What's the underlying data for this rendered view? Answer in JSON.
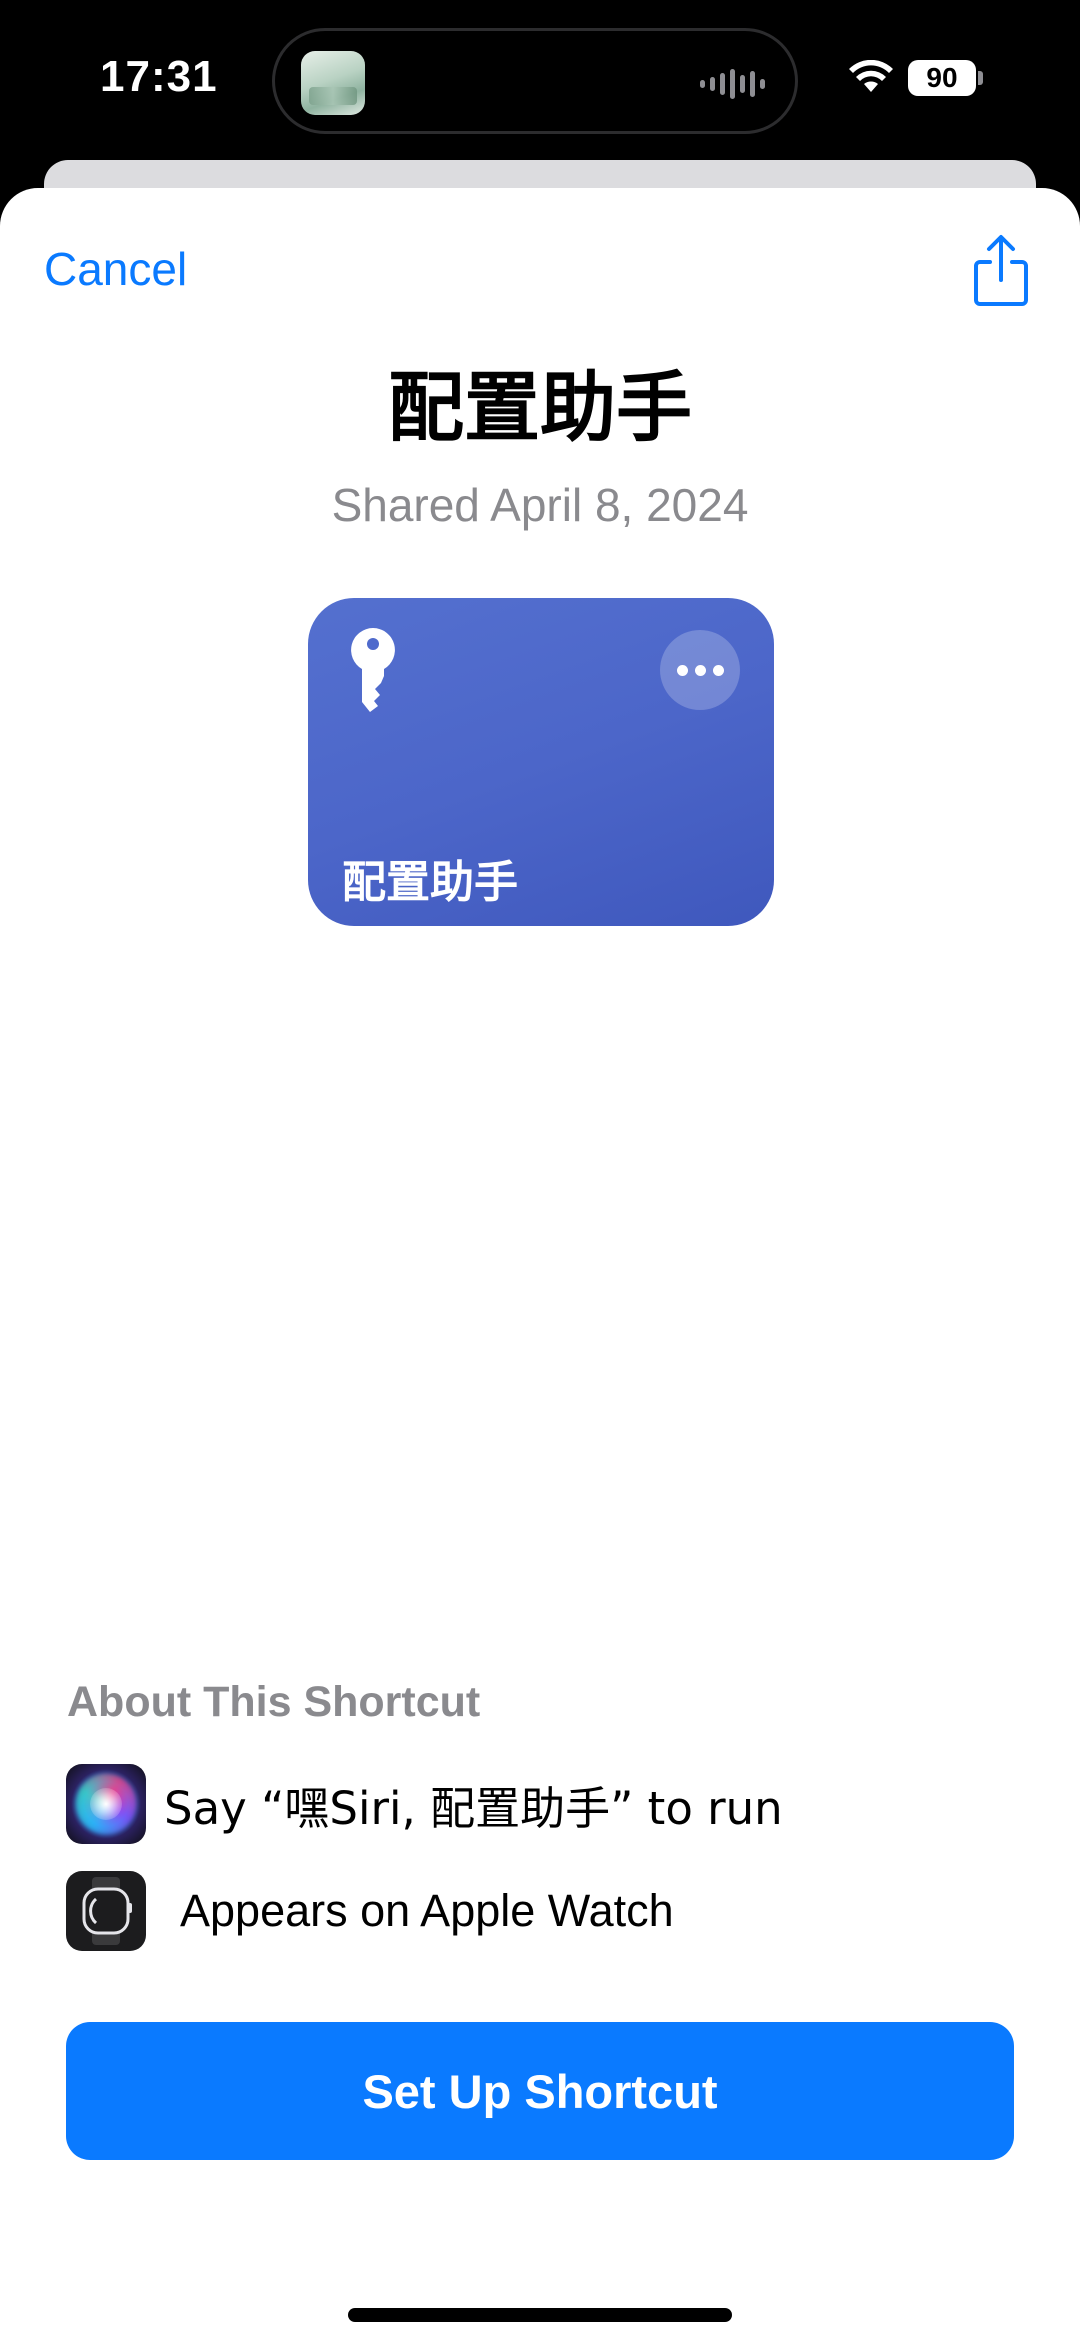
{
  "status_bar": {
    "time": "17:31",
    "battery": "90"
  },
  "sheet": {
    "cancel_label": "Cancel",
    "title": "配置助手",
    "shared_date": "Shared April 8, 2024"
  },
  "shortcut_tile": {
    "label": "配置助手",
    "icon": "key-icon",
    "color": "#4c66c9"
  },
  "about": {
    "heading": "About This Shortcut",
    "items": [
      {
        "icon": "siri-icon",
        "text": "Say “嘿Siri, 配置助手” to run"
      },
      {
        "icon": "apple-watch-icon",
        "text": "Appears on Apple Watch"
      }
    ]
  },
  "actions": {
    "setup_label": "Set Up Shortcut"
  },
  "colors": {
    "accent": "#0a7aff",
    "secondary_text": "#8a8a8e"
  }
}
